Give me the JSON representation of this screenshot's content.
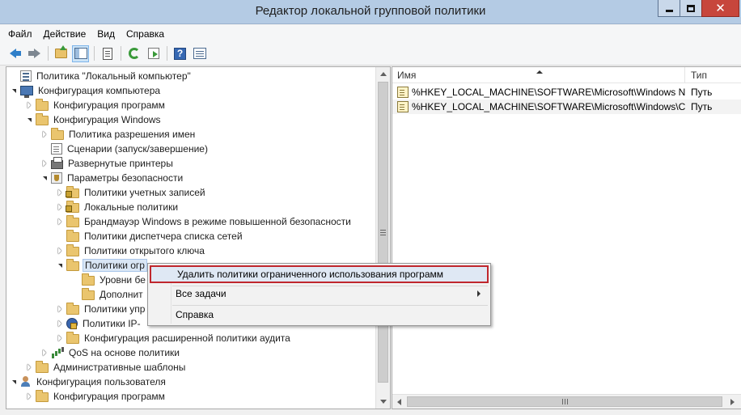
{
  "window": {
    "title": "Редактор локальной групповой политики"
  },
  "menubar": [
    "Файл",
    "Действие",
    "Вид",
    "Справка"
  ],
  "toolbar": {
    "icons": [
      "back-arrow-icon",
      "forward-arrow-icon",
      "folder-up-icon",
      "show-hide-tree-icon",
      "properties-icon",
      "refresh-icon",
      "export-list-icon",
      "help-icon",
      "details-icon"
    ]
  },
  "tree": [
    {
      "label": "Политика \"Локальный компьютер\"",
      "level": 0,
      "expander": "none",
      "icon": "policy"
    },
    {
      "label": "Конфигурация компьютера",
      "level": 0,
      "expander": "open",
      "icon": "computer"
    },
    {
      "label": "Конфигурация программ",
      "level": 1,
      "expander": "closed",
      "icon": "folder"
    },
    {
      "label": "Конфигурация Windows",
      "level": 1,
      "expander": "open",
      "icon": "folder"
    },
    {
      "label": "Политика разрешения имен",
      "level": 2,
      "expander": "closed",
      "icon": "folder"
    },
    {
      "label": "Сценарии (запуск/завершение)",
      "level": 2,
      "expander": "none",
      "icon": "scripts"
    },
    {
      "label": "Развернутые принтеры",
      "level": 2,
      "expander": "closed",
      "icon": "printer"
    },
    {
      "label": "Параметры безопасности",
      "level": 2,
      "expander": "open",
      "icon": "security"
    },
    {
      "label": "Политики учетных записей",
      "level": 3,
      "expander": "closed",
      "icon": "lockfolder"
    },
    {
      "label": "Локальные политики",
      "level": 3,
      "expander": "closed",
      "icon": "lockfolder"
    },
    {
      "label": "Брандмауэр Windows в режиме повышенной безопасности",
      "level": 3,
      "expander": "closed",
      "icon": "folder"
    },
    {
      "label": "Политики диспетчера списка сетей",
      "level": 3,
      "expander": "none",
      "icon": "folder"
    },
    {
      "label": "Политики открытого ключа",
      "level": 3,
      "expander": "closed",
      "icon": "folder"
    },
    {
      "label": "Политики огр",
      "level": 3,
      "expander": "open",
      "icon": "folder",
      "selected": true
    },
    {
      "label": "Уровни бе",
      "level": 4,
      "expander": "none",
      "icon": "folder"
    },
    {
      "label": "Дополнит",
      "level": 4,
      "expander": "none",
      "icon": "folder"
    },
    {
      "label": "Политики упр",
      "level": 3,
      "expander": "closed",
      "icon": "folder"
    },
    {
      "label": "Политики IP-",
      "level": 3,
      "expander": "closed",
      "icon": "ipsec"
    },
    {
      "label": "Конфигурация расширенной политики аудита",
      "level": 3,
      "expander": "closed",
      "icon": "folder"
    },
    {
      "label": "QoS на основе политики",
      "level": 2,
      "expander": "closed",
      "icon": "qos"
    },
    {
      "label": "Административные шаблоны",
      "level": 1,
      "expander": "closed",
      "icon": "folder"
    },
    {
      "label": "Конфигурация пользователя",
      "level": 0,
      "expander": "open",
      "icon": "user"
    },
    {
      "label": "Конфигурация программ",
      "level": 1,
      "expander": "closed",
      "icon": "folder"
    }
  ],
  "list": {
    "columns": [
      "Имя",
      "Тип"
    ],
    "rows": [
      {
        "name": "%HKEY_LOCAL_MACHINE\\SOFTWARE\\Microsoft\\Windows N...",
        "type": "Путь"
      },
      {
        "name": "%HKEY_LOCAL_MACHINE\\SOFTWARE\\Microsoft\\Windows\\C...",
        "type": "Путь"
      }
    ]
  },
  "context_menu": {
    "items": [
      {
        "label": "Удалить политики ограниченного использования программ",
        "highlighted": true
      },
      {
        "label": "Все задачи",
        "submenu": true
      },
      {
        "label": "Справка"
      }
    ]
  }
}
